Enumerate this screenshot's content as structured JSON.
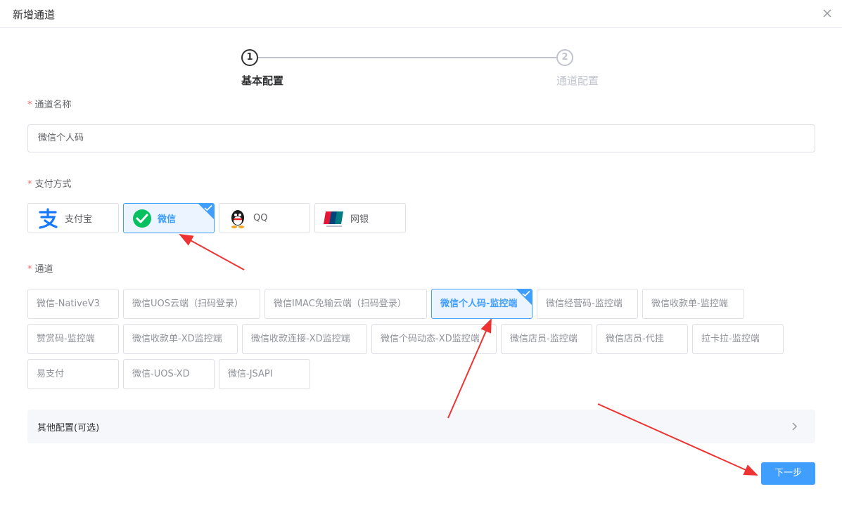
{
  "dialog": {
    "title": "新增通道"
  },
  "steps": [
    {
      "num": "1",
      "label": "基本配置"
    },
    {
      "num": "2",
      "label": "通道配置"
    }
  ],
  "form": {
    "channel_name_label": "通道名称",
    "channel_name_value": "微信个人码",
    "pay_method_label": "支付方式",
    "channel_label": "通道"
  },
  "pay_methods": [
    {
      "label": "支付宝",
      "icon": "alipay-icon",
      "selected": false
    },
    {
      "label": "微信",
      "icon": "wechat-icon",
      "selected": true
    },
    {
      "label": "QQ",
      "icon": "qq-icon",
      "selected": false
    },
    {
      "label": "网银",
      "icon": "unionpay-icon",
      "selected": false
    }
  ],
  "channels": [
    {
      "label": "微信-NativeV3",
      "selected": false
    },
    {
      "label": "微信UOS云端（扫码登录）",
      "selected": false
    },
    {
      "label": "微信IMAC免输云端（扫码登录）",
      "selected": false
    },
    {
      "label": "微信个人码-监控端",
      "selected": true
    },
    {
      "label": "微信经营码-监控端",
      "selected": false
    },
    {
      "label": "微信收款单-监控端",
      "selected": false
    },
    {
      "label": "赞赏码-监控端",
      "selected": false
    },
    {
      "label": "微信收款单-XD监控端",
      "selected": false
    },
    {
      "label": "微信收款连接-XD监控端",
      "selected": false
    },
    {
      "label": "微信个码动态-XD监控端",
      "selected": false
    },
    {
      "label": "微信店员-监控端",
      "selected": false
    },
    {
      "label": "微信店员-代挂",
      "selected": false
    },
    {
      "label": "拉卡拉-监控端",
      "selected": false
    },
    {
      "label": "易支付",
      "selected": false
    },
    {
      "label": "微信-UOS-XD",
      "selected": false
    },
    {
      "label": "微信-JSAPI",
      "selected": false
    }
  ],
  "other_config": {
    "label": "其他配置(可选)"
  },
  "buttons": {
    "next_label": "下一步"
  },
  "colors": {
    "primary": "#409eff",
    "required": "#f56c6c",
    "annotation": "#ee3333"
  }
}
